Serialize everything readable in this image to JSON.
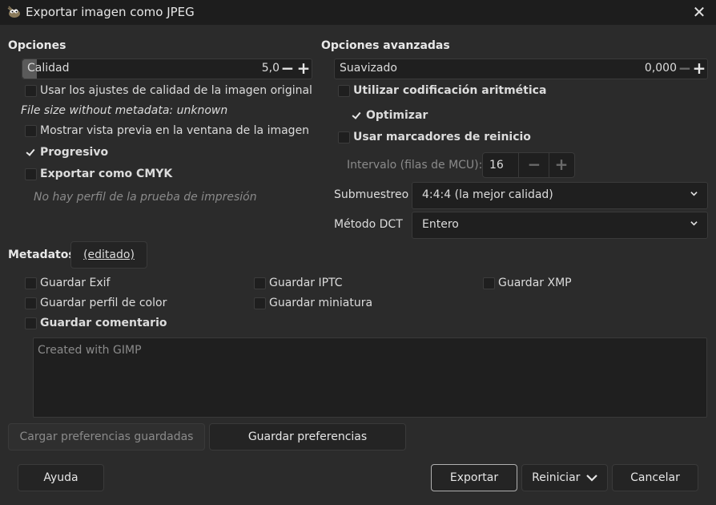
{
  "window": {
    "title": "Exportar imagen como JPEG",
    "close_glyph": "✕"
  },
  "options": {
    "header": "Opciones",
    "quality": {
      "label": "Calidad",
      "value": "5,0",
      "fill_fraction": 0.05
    },
    "use_original_quality": "Usar los ajustes de calidad de la imagen original",
    "file_size": "File size without metadata: unknown",
    "show_preview": "Mostrar vista previa en la ventana de la imagen",
    "progressive": "Progresivo",
    "export_cmyk": "Exportar como CMYK",
    "no_profile": "No hay perfil de la prueba de impresión"
  },
  "advanced": {
    "header": "Opciones avanzadas",
    "smoothing": {
      "label": "Suavizado",
      "value": "0,000"
    },
    "arithmetic": "Utilizar codificación aritmética",
    "optimize": "Optimizar",
    "restart_markers": "Usar marcadores de reinicio",
    "interval": {
      "label": "Intervalo (filas de MCU):",
      "value": "16"
    },
    "subsampling": {
      "label": "Submuestreo",
      "value": "4:4:4 (la mejor calidad)"
    },
    "dct": {
      "label": "Método DCT",
      "value": "Entero"
    }
  },
  "metadata": {
    "header": "Metadatos",
    "edited": "(editado)",
    "exif": "Guardar Exif",
    "iptc": "Guardar IPTC",
    "xmp": "Guardar XMP",
    "color_profile": "Guardar perfil de color",
    "thumbnail": "Guardar miniatura",
    "comment": "Guardar comentario",
    "comment_text": "Created with GIMP"
  },
  "prefs": {
    "load": "Cargar preferencias guardadas",
    "save": "Guardar preferencias"
  },
  "footer": {
    "help": "Ayuda",
    "export": "Exportar",
    "reset": "Reiniciar",
    "cancel": "Cancelar"
  },
  "symbols": {
    "minus": "−",
    "plus": "+"
  },
  "icons": {
    "app": "gimp-wilber-icon",
    "dropdown": "chevron-down-icon"
  }
}
